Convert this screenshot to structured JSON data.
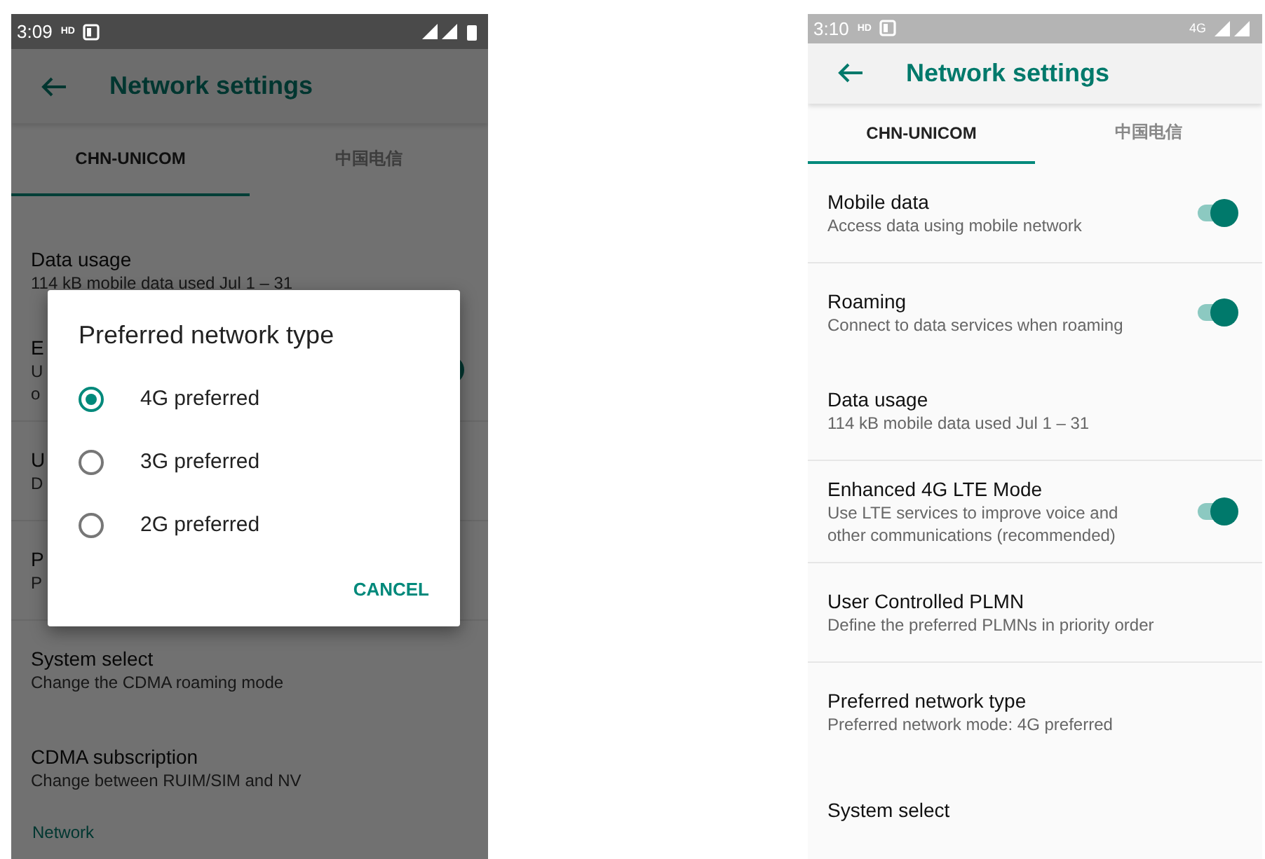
{
  "phones": [
    {
      "status_bar": {
        "time": "3:09",
        "badge": "HD"
      },
      "title": "Network settings",
      "tabs": [
        {
          "label": "CHN-UNICOM",
          "selected": true
        },
        {
          "label": "中国电信",
          "selected": false
        }
      ],
      "items": [
        {
          "kind": "text",
          "title": "Data usage",
          "summary": [
            "114 kB mobile data used Jul 1 – 31"
          ],
          "divider": false
        },
        {
          "kind": "switch",
          "title": "E",
          "summary": [
            "U",
            "o"
          ],
          "on": true,
          "divider": true
        },
        {
          "kind": "text",
          "title": "U",
          "summary": [
            "D"
          ],
          "divider": true
        },
        {
          "kind": "text",
          "title": "P",
          "summary": [
            "P"
          ],
          "divider": true
        },
        {
          "kind": "text",
          "title": "System select",
          "summary": [
            "Change the CDMA roaming mode"
          ],
          "divider": false
        },
        {
          "kind": "text",
          "title": "CDMA subscription",
          "summary": [
            "Change between RUIM/SIM and NV"
          ],
          "divider": false
        },
        {
          "kind": "header",
          "title": "Network"
        }
      ],
      "dialog": {
        "title": "Preferred network type",
        "options": [
          {
            "label": "4G preferred",
            "selected": true
          },
          {
            "label": "3G preferred",
            "selected": false
          },
          {
            "label": "2G preferred",
            "selected": false
          }
        ],
        "button": "CANCEL"
      }
    },
    {
      "status_bar": {
        "time": "3:10",
        "badge": "HD",
        "network": "4G"
      },
      "title": "Network settings",
      "tabs": [
        {
          "label": "CHN-UNICOM",
          "selected": true
        },
        {
          "label": "中国电信",
          "selected": false
        }
      ],
      "items": [
        {
          "kind": "switch",
          "title": "Mobile data",
          "summary": [
            "Access data using mobile network"
          ],
          "on": true,
          "divider": true
        },
        {
          "kind": "switch",
          "title": "Roaming",
          "summary": [
            "Connect to data services when roaming"
          ],
          "on": true,
          "divider": false
        },
        {
          "kind": "text",
          "title": "Data usage",
          "summary": [
            "114 kB mobile data used Jul 1 – 31"
          ],
          "divider": true
        },
        {
          "kind": "switch",
          "title": "Enhanced 4G LTE Mode",
          "summary": [
            "Use LTE services to improve voice and",
            "other communications (recommended)"
          ],
          "on": true,
          "divider": true
        },
        {
          "kind": "text",
          "title": "User Controlled PLMN",
          "summary": [
            "Define the preferred PLMNs in priority order"
          ],
          "divider": true
        },
        {
          "kind": "text",
          "title": "Preferred network type",
          "summary": [
            "Preferred network mode: 4G preferred"
          ],
          "divider": false
        },
        {
          "kind": "text",
          "title": "System select",
          "divider": false
        }
      ]
    }
  ]
}
